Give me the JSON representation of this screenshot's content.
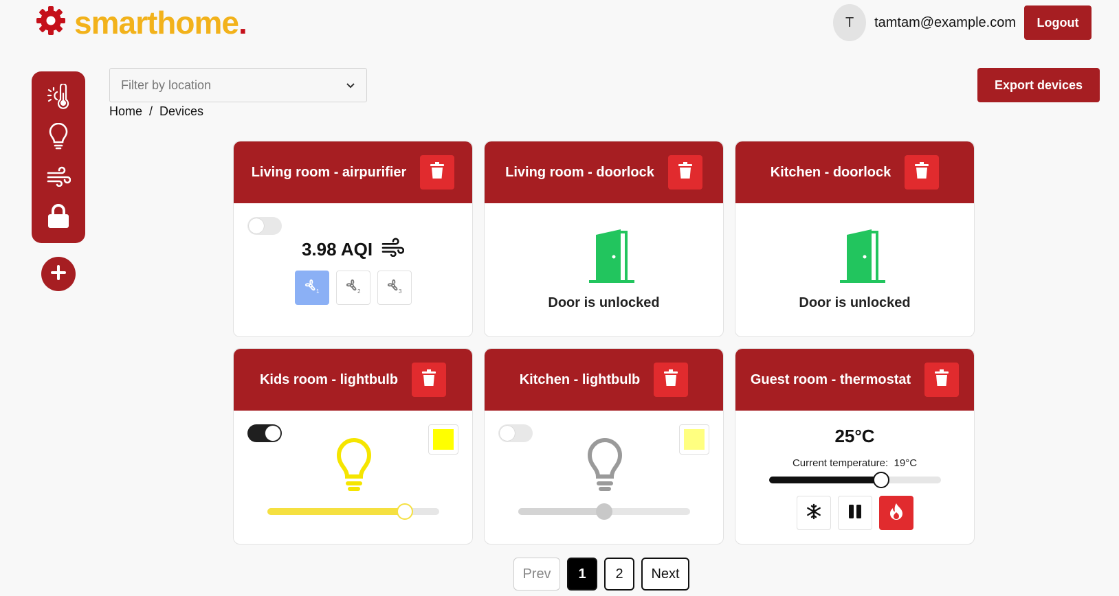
{
  "brand": {
    "name": "smarthome",
    "dot": "."
  },
  "user": {
    "initial": "T",
    "email": "tamtam@example.com",
    "logout_label": "Logout"
  },
  "sidebar": {
    "items": [
      {
        "name": "thermostat",
        "icon": "thermostat-icon"
      },
      {
        "name": "lightbulb",
        "icon": "lightbulb-icon"
      },
      {
        "name": "airpurifier",
        "icon": "wind-icon"
      },
      {
        "name": "doorlock",
        "icon": "lock-icon"
      }
    ],
    "add_icon": "plus-icon"
  },
  "filter": {
    "placeholder": "Filter by location"
  },
  "breadcrumb": {
    "items": [
      "Home",
      "/",
      "Devices"
    ]
  },
  "export_label": "Export devices",
  "devices": {
    "airpurifier": {
      "title": "Living room - airpurifier",
      "on": false,
      "aqi": "3.98 AQI",
      "speeds": [
        "1",
        "2",
        "3"
      ],
      "active_speed": 1
    },
    "doorlock1": {
      "title": "Living room - doorlock",
      "status": "Door is unlocked"
    },
    "doorlock2": {
      "title": "Kitchen - doorlock",
      "status": "Door is unlocked"
    },
    "bulb1": {
      "title": "Kids room - lightbulb",
      "on": true,
      "color": "#ffff00",
      "brightness": 0.8
    },
    "bulb2": {
      "title": "Kitchen - lightbulb",
      "on": false,
      "color": "#ffff80",
      "brightness": 0.5
    },
    "thermostat": {
      "title": "Guest room - thermostat",
      "target": "25°C",
      "current_label": "Current temperature:",
      "current_value": "19°C",
      "level": 0.65,
      "mode": "heat"
    }
  },
  "pagination": {
    "prev": "Prev",
    "pages": [
      "1",
      "2"
    ],
    "current": "1",
    "next": "Next"
  },
  "colors": {
    "brand_red": "#a61e22",
    "trash_red": "#e12b2e",
    "logo_yellow": "#f2b21b",
    "door_green": "#22c55e",
    "speed_active": "#8bb0f5"
  }
}
